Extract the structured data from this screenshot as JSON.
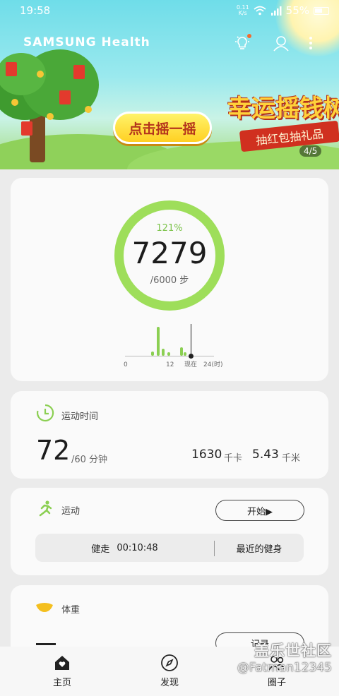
{
  "status_bar": {
    "time": "19:58",
    "net_speed_top": "0.11",
    "net_speed_bottom": "K/s",
    "battery": "55%"
  },
  "header": {
    "app_name": "SAMSUNG Health"
  },
  "banner": {
    "button_label": "点击摇一摇",
    "promo_title": "幸运摇钱树",
    "promo_subtitle": "抽红包抽礼品",
    "page_indicator": "4/5"
  },
  "steps": {
    "percent": "121%",
    "count": "7279",
    "goal": "/6000 步",
    "hourly_bars": [
      {
        "hour": 7.5,
        "level": 0.12
      },
      {
        "hour": 9,
        "level": 0.85
      },
      {
        "hour": 10.5,
        "level": 0.2
      },
      {
        "hour": 12,
        "level": 0.1
      },
      {
        "hour": 15.5,
        "level": 0.24
      },
      {
        "hour": 16.5,
        "level": 0.1
      }
    ],
    "ticks": {
      "start": "0",
      "mid": "12",
      "now": "现在",
      "end": "24(时)"
    }
  },
  "exercise_time": {
    "label": "运动时间",
    "minutes": "72",
    "goal": "/60 分钟",
    "calories": "1630",
    "calories_unit": "千卡",
    "distance": "5.43",
    "distance_unit": "千米"
  },
  "workout": {
    "label": "运动",
    "start_button": "开始▶",
    "activity": "健走",
    "duration": "00:10:48",
    "recent_link": "最近的健身"
  },
  "weight": {
    "label": "体重",
    "record_button": "记录"
  },
  "bottom_nav": [
    {
      "label": "主页",
      "icon": "home-heart-icon"
    },
    {
      "label": "发现",
      "icon": "compass-icon"
    },
    {
      "label": "圈子",
      "icon": "people-icon"
    }
  ],
  "watermark": {
    "line1": "盖乐世社区",
    "line2": "@Fatman12345"
  }
}
